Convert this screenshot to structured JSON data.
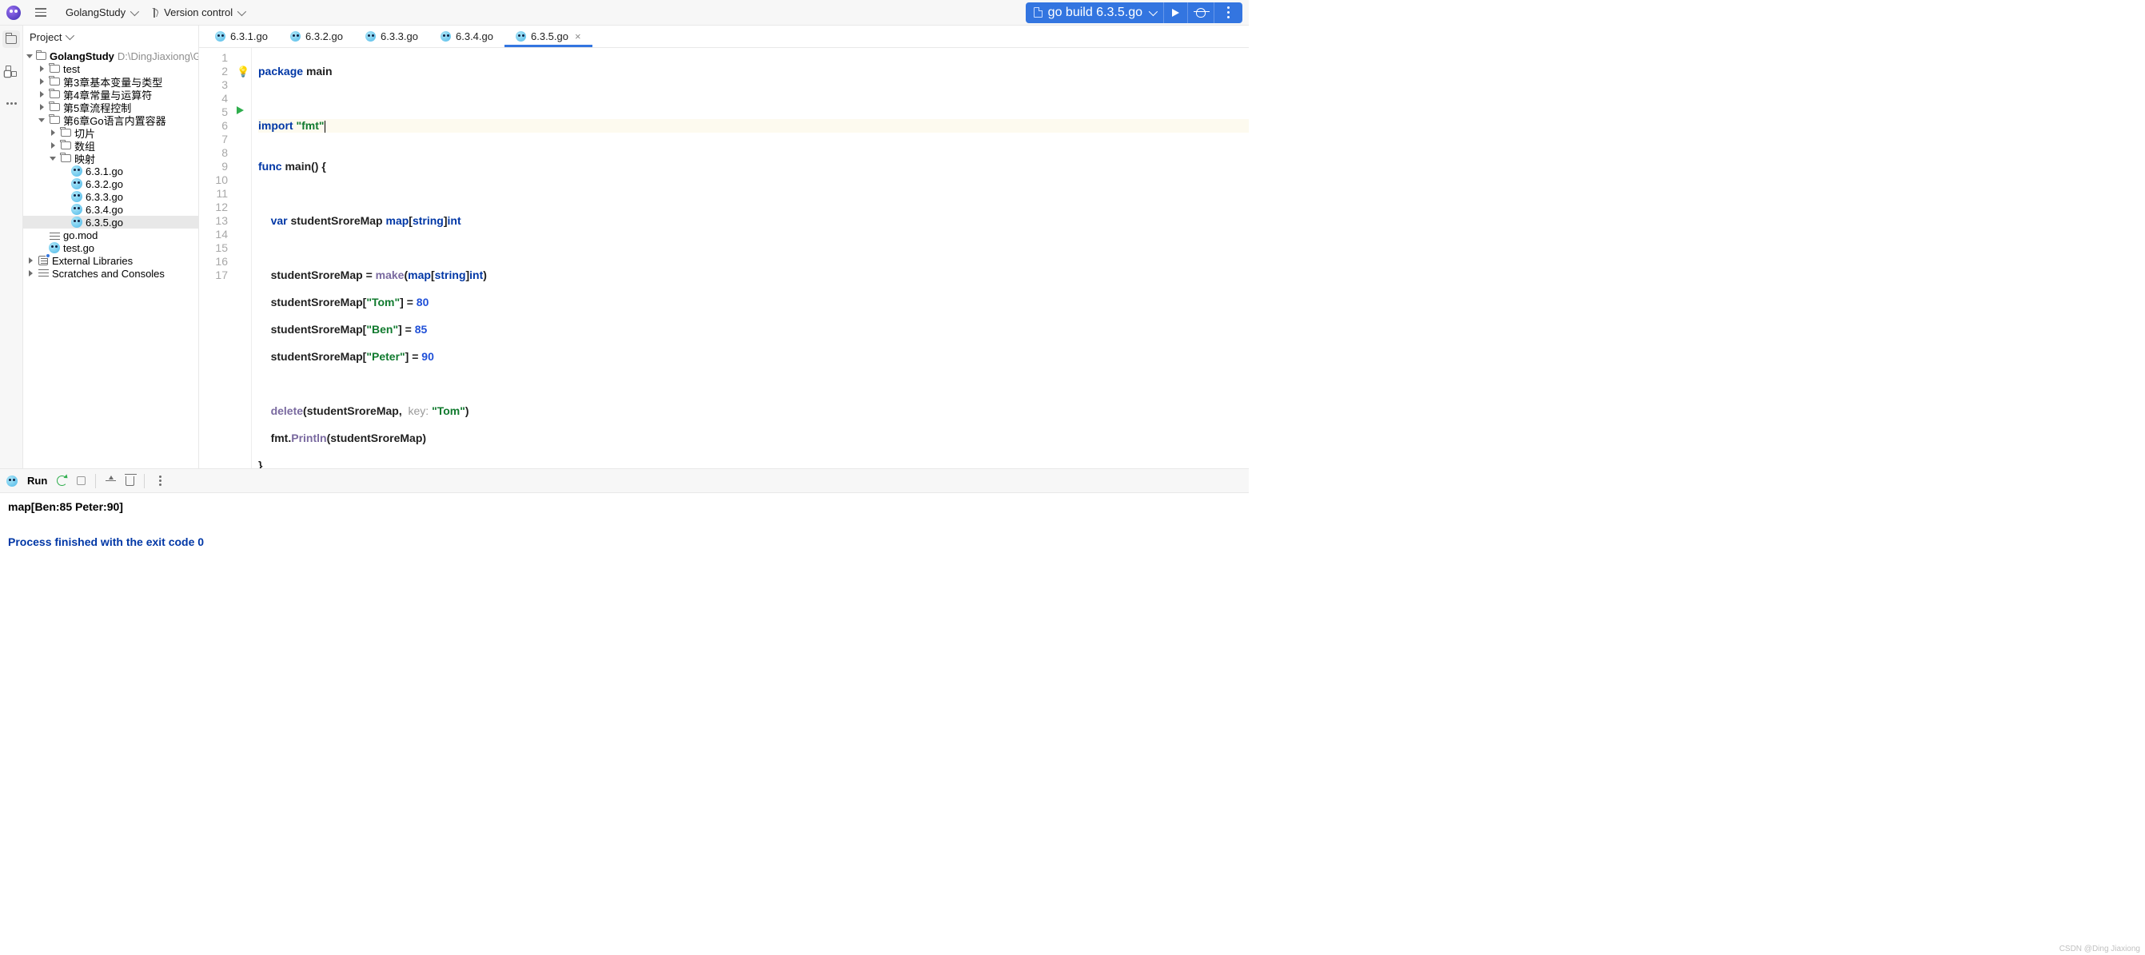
{
  "titlebar": {
    "project_name": "GolangStudy",
    "vcs_label": "Version control"
  },
  "run_config": {
    "label": "go build 6.3.5.go"
  },
  "sidebar": {
    "title": "Project",
    "root": {
      "name": "GolangStudy",
      "path": "D:\\DingJiaxiong\\GolangStudy"
    },
    "folders": {
      "test": "test",
      "ch3": "第3章基本变量与类型",
      "ch4": "第4章常量与运算符",
      "ch5": "第5章流程控制",
      "ch6": "第6章Go语言内置容器",
      "slice": "切片",
      "array": "数组",
      "map": "映射"
    },
    "gofiles": [
      "6.3.1.go",
      "6.3.2.go",
      "6.3.3.go",
      "6.3.4.go",
      "6.3.5.go"
    ],
    "gomod": "go.mod",
    "testgo": "test.go",
    "external": "External Libraries",
    "scratches": "Scratches and Consoles"
  },
  "tabs": [
    "6.3.1.go",
    "6.3.2.go",
    "6.3.3.go",
    "6.3.4.go",
    "6.3.5.go"
  ],
  "editor": {
    "line_numbers": [
      "1",
      "2",
      "3",
      "4",
      "5",
      "6",
      "7",
      "8",
      "9",
      "10",
      "11",
      "12",
      "13",
      "14",
      "15",
      "16",
      "17"
    ],
    "code": {
      "l1": {
        "kw": "package",
        "sp": " ",
        "id": "main"
      },
      "l3": {
        "kw": "import",
        "sp": " ",
        "str": "\"fmt\""
      },
      "l5": {
        "kw": "func",
        "sp": " ",
        "id": "main",
        "rest": "() {"
      },
      "l7": {
        "indent": "    ",
        "kw": "var",
        "sp": " ",
        "id": "studentSroreMap",
        "sp2": " ",
        "t1": "map",
        "br": "[",
        "t2": "string",
        "br2": "]",
        "t3": "int"
      },
      "l9": {
        "indent": "    ",
        "id": "studentSroreMap = ",
        "fn": "make",
        "rest1": "(",
        "t1": "map",
        "br": "[",
        "t2": "string",
        "br2": "]",
        "t3": "int",
        "rest2": ")"
      },
      "l10": {
        "indent": "    ",
        "id": "studentSroreMap[",
        "str": "\"Tom\"",
        "rest": "] = ",
        "num": "80"
      },
      "l11": {
        "indent": "    ",
        "id": "studentSroreMap[",
        "str": "\"Ben\"",
        "rest": "] = ",
        "num": "85"
      },
      "l12": {
        "indent": "    ",
        "id": "studentSroreMap[",
        "str": "\"Peter\"",
        "rest": "] = ",
        "num": "90"
      },
      "l14": {
        "indent": "    ",
        "fn": "delete",
        "rest1": "(studentSroreMap,  ",
        "hint": "key: ",
        "str": "\"Tom\"",
        "rest2": ")"
      },
      "l15": {
        "indent": "    ",
        "id": "fmt.",
        "fn": "Println",
        "rest": "(studentSroreMap)"
      },
      "l16": {
        "text": "}"
      }
    }
  },
  "run_panel": {
    "label": "Run",
    "output_line": "map[Ben:85 Peter:90]",
    "exit_line": "Process finished with the exit code 0"
  },
  "watermark": "CSDN @Ding Jiaxiong"
}
